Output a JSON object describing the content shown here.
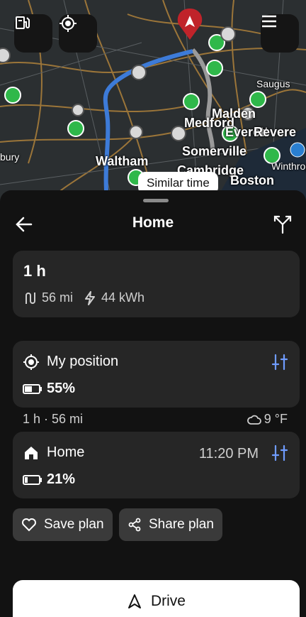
{
  "map": {
    "labels": [
      "Malden",
      "Medford",
      "Everett",
      "Revere",
      "Somerville",
      "Waltham",
      "Cambridge",
      "Boston",
      "Saugus",
      "Winthrop",
      "bury"
    ],
    "tooltip": "Similar time",
    "buttons": {
      "chargers_icon": "ev-station-icon",
      "locate_icon": "crosshair-icon",
      "menu_icon": "hamburger-menu-icon"
    }
  },
  "sheet": {
    "title": "Home",
    "summary": {
      "duration": "1 h",
      "distance": "56 mi",
      "energy": "44 kWh"
    },
    "origin": {
      "name": "My position",
      "battery": "55%"
    },
    "leg": {
      "info": "1 h · 56 mi",
      "weather": "9 °F"
    },
    "destination": {
      "name": "Home",
      "arrival": "11:20 PM",
      "battery": "21%"
    },
    "actions": {
      "save": "Save plan",
      "share": "Share plan"
    },
    "drive": "Drive"
  },
  "colors": {
    "accent": "#6f9cff",
    "route": "#3d7bd8",
    "charger": "#2fb84a",
    "pin": "#c0232a"
  }
}
